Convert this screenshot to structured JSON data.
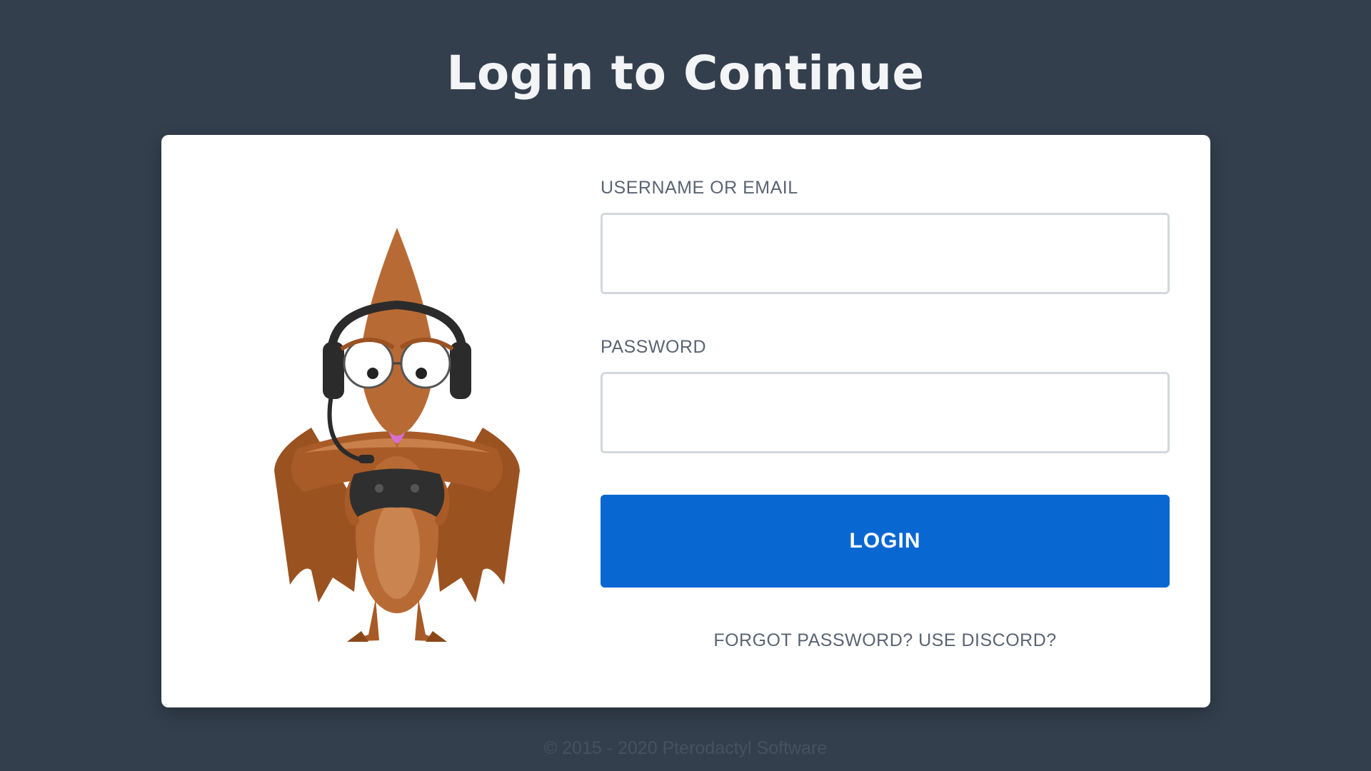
{
  "page": {
    "title": "Login to Continue"
  },
  "form": {
    "username_label": "USERNAME OR EMAIL",
    "username_value": "",
    "username_placeholder": "",
    "password_label": "PASSWORD",
    "password_value": "",
    "password_placeholder": "",
    "login_label": "LOGIN",
    "forgot_label": "FORGOT PASSWORD? USE DISCORD?"
  },
  "footer": {
    "copyright": "© 2015 - 2020 Pterodactyl Software"
  },
  "mascot": {
    "icon": "pterodactyl-gamer-mascot"
  },
  "colors": {
    "background": "#333f4d",
    "card": "#ffffff",
    "accent": "#0967d2",
    "label": "#5a6472",
    "mascot_body": "#b86a35"
  }
}
